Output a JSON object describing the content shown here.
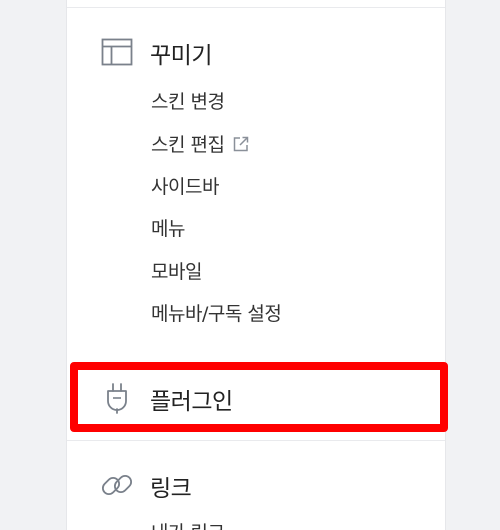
{
  "sections": {
    "decorate": {
      "title": "꾸미기",
      "icon": "layout-icon",
      "items": [
        {
          "label": "스킨 변경"
        },
        {
          "label": "스킨 편집",
          "icon": "external-link-icon"
        },
        {
          "label": "사이드바"
        },
        {
          "label": "메뉴"
        },
        {
          "label": "모바일"
        },
        {
          "label": "메뉴바/구독 설정"
        }
      ]
    },
    "plugin": {
      "title": "플러그인",
      "icon": "plug-icon",
      "highlighted": true
    },
    "link": {
      "title": "링크",
      "icon": "link-icon",
      "items": [
        {
          "label": "내가 링크"
        }
      ]
    }
  },
  "colors": {
    "highlight": "#ff0000",
    "icon": "#7a818b",
    "text": "#333333",
    "background": "#f1f2f4"
  }
}
